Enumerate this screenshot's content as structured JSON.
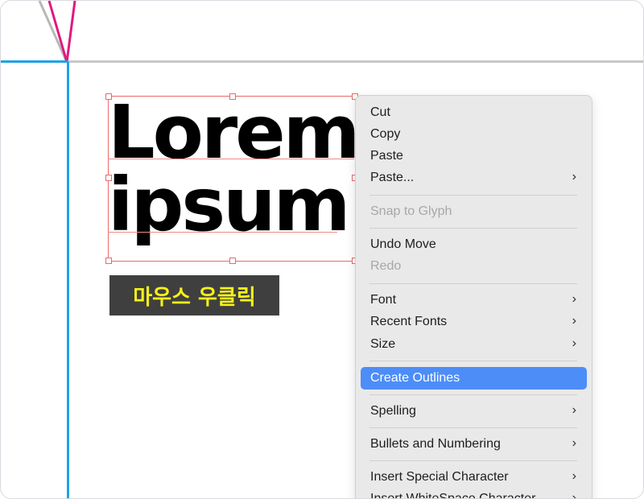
{
  "canvas": {
    "text_lines": [
      "Lorem",
      "ipsum"
    ],
    "caption": "마우스 우클릭",
    "colors": {
      "guide_blue": "#1fa2e6",
      "guide_gray": "#c8c8c8",
      "selection_red": "#e86a6a",
      "caption_bg": "#3f3f3f",
      "caption_text": "#f6f11a",
      "crop_mark_magenta": "#e0197f"
    }
  },
  "context_menu": {
    "items": [
      {
        "label": "Cut",
        "enabled": true
      },
      {
        "label": "Copy",
        "enabled": true
      },
      {
        "label": "Paste",
        "enabled": true
      },
      {
        "label": "Paste...",
        "enabled": true,
        "submenu": true
      },
      {
        "label": "Snap to Glyph",
        "enabled": false
      },
      {
        "label": "Undo Move",
        "enabled": true
      },
      {
        "label": "Redo",
        "enabled": false
      },
      {
        "label": "Font",
        "enabled": true,
        "submenu": true
      },
      {
        "label": "Recent Fonts",
        "enabled": true,
        "submenu": true
      },
      {
        "label": "Size",
        "enabled": true,
        "submenu": true
      },
      {
        "label": "Create Outlines",
        "enabled": true,
        "highlighted": true
      },
      {
        "label": "Spelling",
        "enabled": true,
        "submenu": true
      },
      {
        "label": "Bullets and Numbering",
        "enabled": true,
        "submenu": true
      },
      {
        "label": "Insert Special Character",
        "enabled": true,
        "submenu": true
      },
      {
        "label": "Insert WhiteSpace Character",
        "enabled": true,
        "submenu": true
      }
    ],
    "highlight_color": "#4d8df8"
  }
}
